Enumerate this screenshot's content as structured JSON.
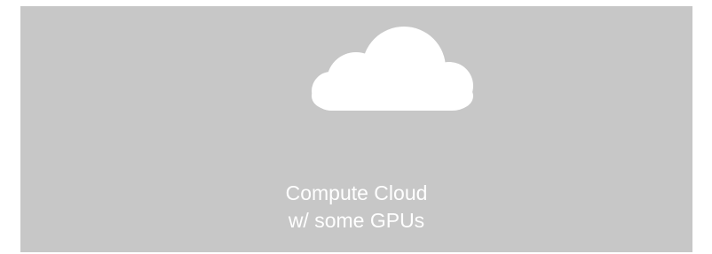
{
  "node": {
    "icon": "cloud-icon",
    "caption_line1": "Compute Cloud",
    "caption_line2": "w/ some GPUs"
  },
  "colors": {
    "panel_background": "#c7c7c7",
    "icon": "#ffffff",
    "text": "#ffffff"
  }
}
